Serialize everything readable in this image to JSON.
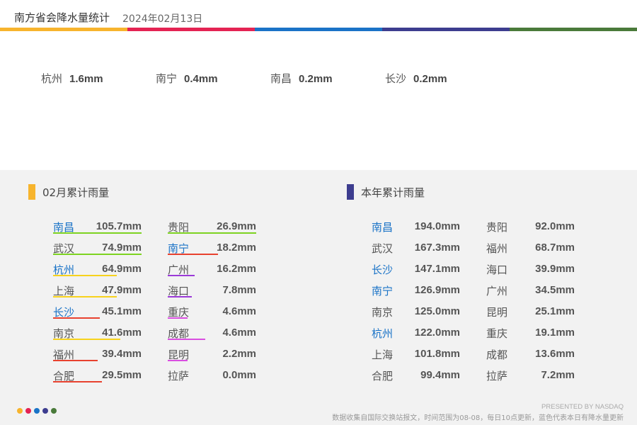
{
  "header": {
    "title": "南方省会降水量统计",
    "date": "2024年02月13日"
  },
  "stripe_colors": [
    "#f7b42d",
    "#e42353",
    "#1a73c7",
    "#3d3d8f",
    "#4a7a3a"
  ],
  "today": [
    {
      "city": "杭州",
      "value": "1.6mm"
    },
    {
      "city": "南宁",
      "value": "0.4mm"
    },
    {
      "city": "南昌",
      "value": "0.2mm"
    },
    {
      "city": "长沙",
      "value": "0.2mm"
    }
  ],
  "monthly": {
    "title": "02月累计雨量",
    "color": "#f7b42d",
    "col1": [
      {
        "city": "南昌",
        "value": "105.7mm",
        "hl": true,
        "line": "#7ed321",
        "frac": 1.0
      },
      {
        "city": "武汉",
        "value": "74.9mm",
        "hl": false,
        "line": "#7ed321",
        "frac": 1.0
      },
      {
        "city": "杭州",
        "value": "64.9mm",
        "hl": true,
        "line": "#f7d21d",
        "frac": 0.72
      },
      {
        "city": "上海",
        "value": "47.9mm",
        "hl": false,
        "line": "#f7d21d",
        "frac": 0.72
      },
      {
        "city": "长沙",
        "value": "45.1mm",
        "hl": true,
        "line": "#e8422f",
        "frac": 0.53
      },
      {
        "city": "南京",
        "value": "41.6mm",
        "hl": false,
        "line": "#f7d21d",
        "frac": 0.76
      },
      {
        "city": "福州",
        "value": "39.4mm",
        "hl": false,
        "line": "#e8422f",
        "frac": 0.5
      },
      {
        "city": "合肥",
        "value": "29.5mm",
        "hl": false,
        "line": "#e8422f",
        "frac": 0.55
      }
    ],
    "col2": [
      {
        "city": "贵阳",
        "value": "26.9mm",
        "hl": false,
        "line": "#7ed321",
        "frac": 1.0
      },
      {
        "city": "南宁",
        "value": "18.2mm",
        "hl": true,
        "line": "#e8422f",
        "frac": 0.57
      },
      {
        "city": "广州",
        "value": "16.2mm",
        "hl": false,
        "line": "#9b3ad8",
        "frac": 0.3
      },
      {
        "city": "海口",
        "value": "7.8mm",
        "hl": false,
        "line": "#9b3ad8",
        "frac": 0.27
      },
      {
        "city": "重庆",
        "value": "4.6mm",
        "hl": false,
        "line": "#d94ee0",
        "frac": 0.22
      },
      {
        "city": "成都",
        "value": "4.6mm",
        "hl": false,
        "line": "#d94ee0",
        "frac": 0.42
      },
      {
        "city": "昆明",
        "value": "2.2mm",
        "hl": false,
        "line": "#d94ee0",
        "frac": 0.22
      },
      {
        "city": "拉萨",
        "value": "0.0mm",
        "hl": false,
        "line": "",
        "frac": 0
      }
    ]
  },
  "yearly": {
    "title": "本年累计雨量",
    "color": "#3d3d8f",
    "col1": [
      {
        "city": "南昌",
        "value": "194.0mm",
        "hl": true
      },
      {
        "city": "武汉",
        "value": "167.3mm",
        "hl": false
      },
      {
        "city": "长沙",
        "value": "147.1mm",
        "hl": true
      },
      {
        "city": "南宁",
        "value": "126.9mm",
        "hl": true
      },
      {
        "city": "南京",
        "value": "125.0mm",
        "hl": false
      },
      {
        "city": "杭州",
        "value": "122.0mm",
        "hl": true
      },
      {
        "city": "上海",
        "value": "101.8mm",
        "hl": false
      },
      {
        "city": "合肥",
        "value": "99.4mm",
        "hl": false
      }
    ],
    "col2": [
      {
        "city": "贵阳",
        "value": "92.0mm",
        "hl": false
      },
      {
        "city": "福州",
        "value": "68.7mm",
        "hl": false
      },
      {
        "city": "海口",
        "value": "39.9mm",
        "hl": false
      },
      {
        "city": "广州",
        "value": "34.5mm",
        "hl": false
      },
      {
        "city": "昆明",
        "value": "25.1mm",
        "hl": false
      },
      {
        "city": "重庆",
        "value": "19.1mm",
        "hl": false
      },
      {
        "city": "成都",
        "value": "13.6mm",
        "hl": false
      },
      {
        "city": "拉萨",
        "value": "7.2mm",
        "hl": false
      }
    ]
  },
  "footer": {
    "credit": "PRESENTED BY NASDAQ",
    "note": "数据收集自国际交换站报文，时间范围为08-08，每日10点更新，蓝色代表本日有降水量更新"
  }
}
